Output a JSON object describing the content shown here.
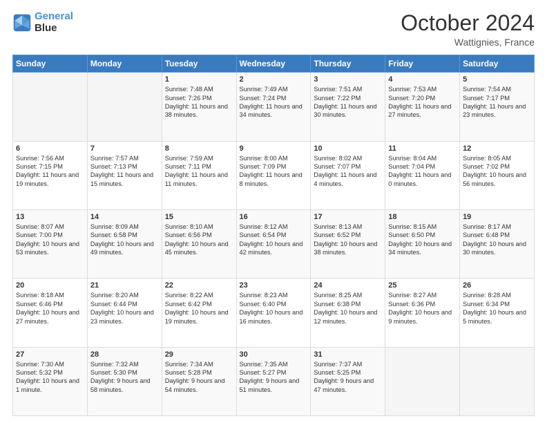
{
  "header": {
    "logo_line1": "General",
    "logo_line2": "Blue",
    "month": "October 2024",
    "location": "Wattignies, France"
  },
  "weekdays": [
    "Sunday",
    "Monday",
    "Tuesday",
    "Wednesday",
    "Thursday",
    "Friday",
    "Saturday"
  ],
  "weeks": [
    [
      {
        "day": "",
        "info": ""
      },
      {
        "day": "",
        "info": ""
      },
      {
        "day": "1",
        "info": "Sunrise: 7:48 AM\nSunset: 7:26 PM\nDaylight: 11 hours and 38 minutes."
      },
      {
        "day": "2",
        "info": "Sunrise: 7:49 AM\nSunset: 7:24 PM\nDaylight: 11 hours and 34 minutes."
      },
      {
        "day": "3",
        "info": "Sunrise: 7:51 AM\nSunset: 7:22 PM\nDaylight: 11 hours and 30 minutes."
      },
      {
        "day": "4",
        "info": "Sunrise: 7:53 AM\nSunset: 7:20 PM\nDaylight: 11 hours and 27 minutes."
      },
      {
        "day": "5",
        "info": "Sunrise: 7:54 AM\nSunset: 7:17 PM\nDaylight: 11 hours and 23 minutes."
      }
    ],
    [
      {
        "day": "6",
        "info": "Sunrise: 7:56 AM\nSunset: 7:15 PM\nDaylight: 11 hours and 19 minutes."
      },
      {
        "day": "7",
        "info": "Sunrise: 7:57 AM\nSunset: 7:13 PM\nDaylight: 11 hours and 15 minutes."
      },
      {
        "day": "8",
        "info": "Sunrise: 7:59 AM\nSunset: 7:11 PM\nDaylight: 11 hours and 11 minutes."
      },
      {
        "day": "9",
        "info": "Sunrise: 8:00 AM\nSunset: 7:09 PM\nDaylight: 11 hours and 8 minutes."
      },
      {
        "day": "10",
        "info": "Sunrise: 8:02 AM\nSunset: 7:07 PM\nDaylight: 11 hours and 4 minutes."
      },
      {
        "day": "11",
        "info": "Sunrise: 8:04 AM\nSunset: 7:04 PM\nDaylight: 11 hours and 0 minutes."
      },
      {
        "day": "12",
        "info": "Sunrise: 8:05 AM\nSunset: 7:02 PM\nDaylight: 10 hours and 56 minutes."
      }
    ],
    [
      {
        "day": "13",
        "info": "Sunrise: 8:07 AM\nSunset: 7:00 PM\nDaylight: 10 hours and 53 minutes."
      },
      {
        "day": "14",
        "info": "Sunrise: 8:09 AM\nSunset: 6:58 PM\nDaylight: 10 hours and 49 minutes."
      },
      {
        "day": "15",
        "info": "Sunrise: 8:10 AM\nSunset: 6:56 PM\nDaylight: 10 hours and 45 minutes."
      },
      {
        "day": "16",
        "info": "Sunrise: 8:12 AM\nSunset: 6:54 PM\nDaylight: 10 hours and 42 minutes."
      },
      {
        "day": "17",
        "info": "Sunrise: 8:13 AM\nSunset: 6:52 PM\nDaylight: 10 hours and 38 minutes."
      },
      {
        "day": "18",
        "info": "Sunrise: 8:15 AM\nSunset: 6:50 PM\nDaylight: 10 hours and 34 minutes."
      },
      {
        "day": "19",
        "info": "Sunrise: 8:17 AM\nSunset: 6:48 PM\nDaylight: 10 hours and 30 minutes."
      }
    ],
    [
      {
        "day": "20",
        "info": "Sunrise: 8:18 AM\nSunset: 6:46 PM\nDaylight: 10 hours and 27 minutes."
      },
      {
        "day": "21",
        "info": "Sunrise: 8:20 AM\nSunset: 6:44 PM\nDaylight: 10 hours and 23 minutes."
      },
      {
        "day": "22",
        "info": "Sunrise: 8:22 AM\nSunset: 6:42 PM\nDaylight: 10 hours and 19 minutes."
      },
      {
        "day": "23",
        "info": "Sunrise: 8:23 AM\nSunset: 6:40 PM\nDaylight: 10 hours and 16 minutes."
      },
      {
        "day": "24",
        "info": "Sunrise: 8:25 AM\nSunset: 6:38 PM\nDaylight: 10 hours and 12 minutes."
      },
      {
        "day": "25",
        "info": "Sunrise: 8:27 AM\nSunset: 6:36 PM\nDaylight: 10 hours and 9 minutes."
      },
      {
        "day": "26",
        "info": "Sunrise: 8:28 AM\nSunset: 6:34 PM\nDaylight: 10 hours and 5 minutes."
      }
    ],
    [
      {
        "day": "27",
        "info": "Sunrise: 7:30 AM\nSunset: 5:32 PM\nDaylight: 10 hours and 1 minute."
      },
      {
        "day": "28",
        "info": "Sunrise: 7:32 AM\nSunset: 5:30 PM\nDaylight: 9 hours and 58 minutes."
      },
      {
        "day": "29",
        "info": "Sunrise: 7:34 AM\nSunset: 5:28 PM\nDaylight: 9 hours and 54 minutes."
      },
      {
        "day": "30",
        "info": "Sunrise: 7:35 AM\nSunset: 5:27 PM\nDaylight: 9 hours and 51 minutes."
      },
      {
        "day": "31",
        "info": "Sunrise: 7:37 AM\nSunset: 5:25 PM\nDaylight: 9 hours and 47 minutes."
      },
      {
        "day": "",
        "info": ""
      },
      {
        "day": "",
        "info": ""
      }
    ]
  ]
}
